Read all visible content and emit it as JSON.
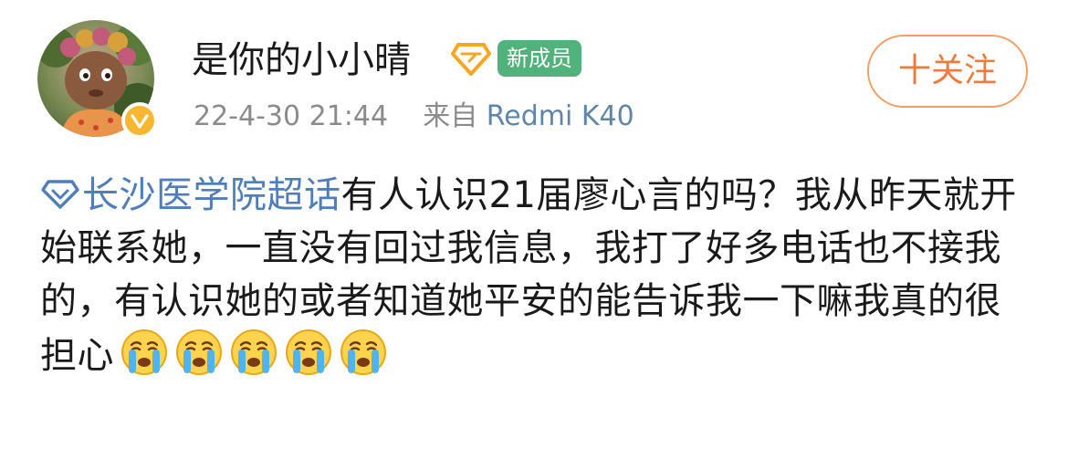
{
  "user": {
    "name": "是你的小小晴",
    "badge_label": "新成员",
    "verify_icon": "verified-badge-icon",
    "vip_icon": "vip-diamond-icon"
  },
  "meta": {
    "timestamp": "22-4-30 21:44",
    "source_prefix": "来自",
    "device": "Redmi K40"
  },
  "follow": {
    "label": "十关注"
  },
  "post": {
    "topic_icon": "super-topic-diamond-icon",
    "topic": "长沙医学院超话",
    "text": "有人认识21届廖心言的吗？我从昨天就开始联系她，一直没有回过我信息，我打了好多电话也不接我的，有认识她的或者知道她平安的能告诉我一下嘛我真的很担心",
    "emoji_name": "crying-face-emoji",
    "emoji_count": 5
  },
  "colors": {
    "link_blue": "#4f7eb8",
    "follow_orange": "#ee7b3c",
    "new_member_green": "#52b27c",
    "verify_gold": "#f7b733",
    "meta_gray": "#8b8b8b"
  }
}
